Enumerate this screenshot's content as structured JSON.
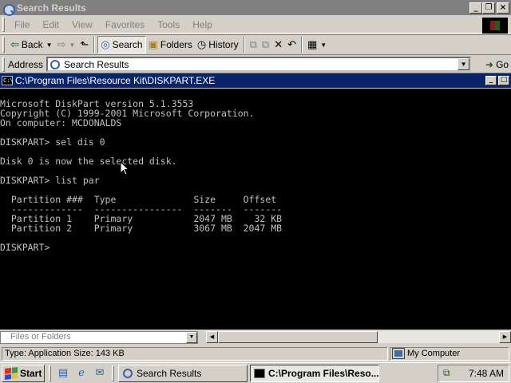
{
  "explorer": {
    "title": "Search Results",
    "menu": [
      "File",
      "Edit",
      "View",
      "Favorites",
      "Tools",
      "Help"
    ],
    "toolbar": {
      "back": "Back",
      "search": "Search",
      "folders": "Folders",
      "history": "History"
    },
    "address": {
      "label": "Address",
      "value": "Search Results",
      "go": "Go"
    },
    "files_of_folders": "Files or Folders",
    "status": {
      "text": "Type: Application Size: 143 KB",
      "zone": "My Computer"
    }
  },
  "console": {
    "title": "C:\\Program Files\\Resource Kit\\DISKPART.EXE",
    "lines": [
      "Microsoft DiskPart version 5.1.3553",
      "Copyright (C) 1999-2001 Microsoft Corporation.",
      "On computer: MCDONALDS",
      "",
      "DISKPART> sel dis 0",
      "",
      "Disk 0 is now the selected disk.",
      "",
      "DISKPART> list par",
      "",
      "  Partition ###  Type              Size     Offset",
      "  -------------  ----------------  -------  -------",
      "  Partition 1    Primary           2047 MB    32 KB",
      "  Partition 2    Primary           3067 MB  2047 MB",
      "",
      "DISKPART>"
    ]
  },
  "taskbar": {
    "start": "Start",
    "tasks": [
      {
        "label": "Search Results",
        "active": false
      },
      {
        "label": "C:\\Program Files\\Reso...",
        "active": true
      }
    ],
    "clock": "7:48 AM"
  }
}
